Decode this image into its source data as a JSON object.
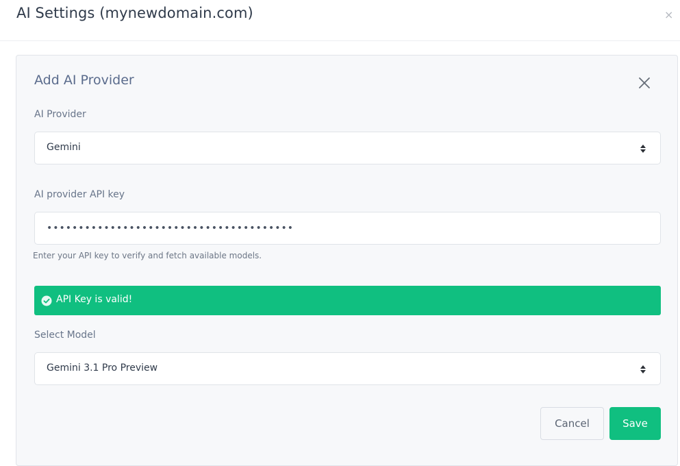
{
  "modal": {
    "title": "AI Settings (mynewdomain.com)",
    "close_glyph": "×"
  },
  "panel": {
    "title": "Add AI Provider",
    "close_icon": "close-x-icon"
  },
  "provider": {
    "label": "AI Provider",
    "selected": "Gemini"
  },
  "api_key": {
    "label": "AI provider API key",
    "masked_value": "•••••••••••••••••••••••••••••••••••••••",
    "help_text": "Enter your API key to verify and fetch available models."
  },
  "alert": {
    "message": "API Key is valid!",
    "icon": "check-circle-icon"
  },
  "model": {
    "label": "Select Model",
    "selected": "Gemini 3.1 Pro Preview"
  },
  "buttons": {
    "cancel_label": "Cancel",
    "save_label": "Save"
  },
  "colors": {
    "success": "#10bf80",
    "panel_background": "#f7f8fa",
    "title_text": "#2f3a4a",
    "label_text": "#68758a"
  }
}
